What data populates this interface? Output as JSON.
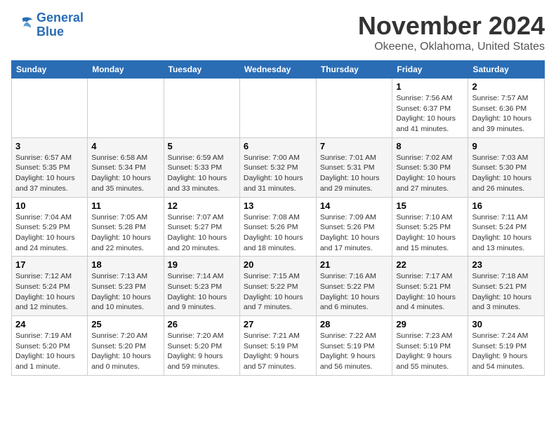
{
  "header": {
    "logo_line1": "General",
    "logo_line2": "Blue",
    "month": "November 2024",
    "location": "Okeene, Oklahoma, United States"
  },
  "weekdays": [
    "Sunday",
    "Monday",
    "Tuesday",
    "Wednesday",
    "Thursday",
    "Friday",
    "Saturday"
  ],
  "weeks": [
    [
      {
        "day": "",
        "detail": ""
      },
      {
        "day": "",
        "detail": ""
      },
      {
        "day": "",
        "detail": ""
      },
      {
        "day": "",
        "detail": ""
      },
      {
        "day": "",
        "detail": ""
      },
      {
        "day": "1",
        "detail": "Sunrise: 7:56 AM\nSunset: 6:37 PM\nDaylight: 10 hours\nand 41 minutes."
      },
      {
        "day": "2",
        "detail": "Sunrise: 7:57 AM\nSunset: 6:36 PM\nDaylight: 10 hours\nand 39 minutes."
      }
    ],
    [
      {
        "day": "3",
        "detail": "Sunrise: 6:57 AM\nSunset: 5:35 PM\nDaylight: 10 hours\nand 37 minutes."
      },
      {
        "day": "4",
        "detail": "Sunrise: 6:58 AM\nSunset: 5:34 PM\nDaylight: 10 hours\nand 35 minutes."
      },
      {
        "day": "5",
        "detail": "Sunrise: 6:59 AM\nSunset: 5:33 PM\nDaylight: 10 hours\nand 33 minutes."
      },
      {
        "day": "6",
        "detail": "Sunrise: 7:00 AM\nSunset: 5:32 PM\nDaylight: 10 hours\nand 31 minutes."
      },
      {
        "day": "7",
        "detail": "Sunrise: 7:01 AM\nSunset: 5:31 PM\nDaylight: 10 hours\nand 29 minutes."
      },
      {
        "day": "8",
        "detail": "Sunrise: 7:02 AM\nSunset: 5:30 PM\nDaylight: 10 hours\nand 27 minutes."
      },
      {
        "day": "9",
        "detail": "Sunrise: 7:03 AM\nSunset: 5:30 PM\nDaylight: 10 hours\nand 26 minutes."
      }
    ],
    [
      {
        "day": "10",
        "detail": "Sunrise: 7:04 AM\nSunset: 5:29 PM\nDaylight: 10 hours\nand 24 minutes."
      },
      {
        "day": "11",
        "detail": "Sunrise: 7:05 AM\nSunset: 5:28 PM\nDaylight: 10 hours\nand 22 minutes."
      },
      {
        "day": "12",
        "detail": "Sunrise: 7:07 AM\nSunset: 5:27 PM\nDaylight: 10 hours\nand 20 minutes."
      },
      {
        "day": "13",
        "detail": "Sunrise: 7:08 AM\nSunset: 5:26 PM\nDaylight: 10 hours\nand 18 minutes."
      },
      {
        "day": "14",
        "detail": "Sunrise: 7:09 AM\nSunset: 5:26 PM\nDaylight: 10 hours\nand 17 minutes."
      },
      {
        "day": "15",
        "detail": "Sunrise: 7:10 AM\nSunset: 5:25 PM\nDaylight: 10 hours\nand 15 minutes."
      },
      {
        "day": "16",
        "detail": "Sunrise: 7:11 AM\nSunset: 5:24 PM\nDaylight: 10 hours\nand 13 minutes."
      }
    ],
    [
      {
        "day": "17",
        "detail": "Sunrise: 7:12 AM\nSunset: 5:24 PM\nDaylight: 10 hours\nand 12 minutes."
      },
      {
        "day": "18",
        "detail": "Sunrise: 7:13 AM\nSunset: 5:23 PM\nDaylight: 10 hours\nand 10 minutes."
      },
      {
        "day": "19",
        "detail": "Sunrise: 7:14 AM\nSunset: 5:23 PM\nDaylight: 10 hours\nand 9 minutes."
      },
      {
        "day": "20",
        "detail": "Sunrise: 7:15 AM\nSunset: 5:22 PM\nDaylight: 10 hours\nand 7 minutes."
      },
      {
        "day": "21",
        "detail": "Sunrise: 7:16 AM\nSunset: 5:22 PM\nDaylight: 10 hours\nand 6 minutes."
      },
      {
        "day": "22",
        "detail": "Sunrise: 7:17 AM\nSunset: 5:21 PM\nDaylight: 10 hours\nand 4 minutes."
      },
      {
        "day": "23",
        "detail": "Sunrise: 7:18 AM\nSunset: 5:21 PM\nDaylight: 10 hours\nand 3 minutes."
      }
    ],
    [
      {
        "day": "24",
        "detail": "Sunrise: 7:19 AM\nSunset: 5:20 PM\nDaylight: 10 hours\nand 1 minute."
      },
      {
        "day": "25",
        "detail": "Sunrise: 7:20 AM\nSunset: 5:20 PM\nDaylight: 10 hours\nand 0 minutes."
      },
      {
        "day": "26",
        "detail": "Sunrise: 7:20 AM\nSunset: 5:20 PM\nDaylight: 9 hours\nand 59 minutes."
      },
      {
        "day": "27",
        "detail": "Sunrise: 7:21 AM\nSunset: 5:19 PM\nDaylight: 9 hours\nand 57 minutes."
      },
      {
        "day": "28",
        "detail": "Sunrise: 7:22 AM\nSunset: 5:19 PM\nDaylight: 9 hours\nand 56 minutes."
      },
      {
        "day": "29",
        "detail": "Sunrise: 7:23 AM\nSunset: 5:19 PM\nDaylight: 9 hours\nand 55 minutes."
      },
      {
        "day": "30",
        "detail": "Sunrise: 7:24 AM\nSunset: 5:19 PM\nDaylight: 9 hours\nand 54 minutes."
      }
    ]
  ]
}
